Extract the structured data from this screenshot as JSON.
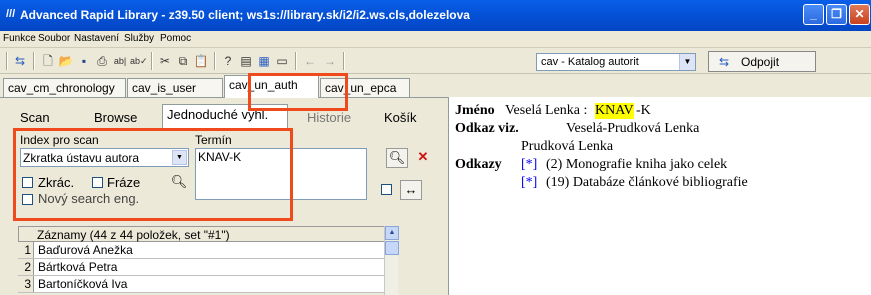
{
  "window": {
    "title": "Advanced Rapid Library - z39.50 client; ws1s://library.sk/i2/i2.ws.cls,dolezelova",
    "icon_glyph": "///",
    "minimize_label": "_",
    "restore_label": "❐",
    "close_label": "✕"
  },
  "menu": [
    "Funkce",
    "Soubor",
    "Nastavení",
    "Služby",
    "Pomoc"
  ],
  "toolbar": {
    "catalog_select": "cav - Katalog autorit",
    "disconnect_label": "Odpojit"
  },
  "outer_tabs": [
    "cav_cm_chronology",
    "cav_is_user",
    "cav_un_auth",
    "cav_un_epca"
  ],
  "active_outer_tab": "cav_un_auth",
  "inner_tabs": [
    "Scan",
    "Browse",
    "Jednoduché vyhl.",
    "Historie",
    "Košík"
  ],
  "active_inner_tab": "Jednoduché vyhl.",
  "search": {
    "index_label": "Index pro scan",
    "index_value": "Zkratka ústavu autora",
    "term_label": "Termín",
    "term_value": "KNAV-K",
    "checkbox_abbrev": "Zkrác.",
    "checkbox_phrase": "Fráze",
    "checkbox_new_search": "Nový search eng."
  },
  "records": {
    "header": "Záznamy (44 z 44 položek, set \"#1\")",
    "rows": [
      {
        "num": "1",
        "name": "Baďurová Anežka"
      },
      {
        "num": "2",
        "name": "Bártková Petra"
      },
      {
        "num": "3",
        "name": "Bartoníčková Iva"
      }
    ]
  },
  "detail": {
    "name_label": "Jméno",
    "name_value": "Veselá Lenka :",
    "name_code_highlight": "KNAV",
    "name_code_rest": "-K",
    "see_label": "Odkaz viz.",
    "see_value_1": "Veselá-Prudková Lenka",
    "see_value_2": "Prudková Lenka",
    "refs_label": "Odkazy",
    "refs": [
      {
        "link": "[*]",
        "text": "(2) Monografie kniha jako celek"
      },
      {
        "link": "[*]",
        "text": "(19) Databáze článkové bibliografie"
      }
    ]
  },
  "colors": {
    "title_bar": "#0552d8",
    "highlight_box": "#ef4a1c",
    "term_highlight": "#ffff00",
    "link": "#0000ee"
  }
}
